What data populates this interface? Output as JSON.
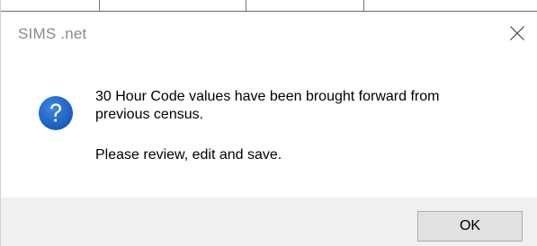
{
  "dialog": {
    "title": "SIMS .net",
    "close_icon": "close-icon",
    "icon": "question-icon",
    "message_line1": "30 Hour Code values have been brought forward from",
    "message_line2": "previous census.",
    "message_line3": "Please review, edit and save.",
    "ok_label": "OK"
  },
  "colors": {
    "title_text": "#8a8a8a",
    "icon_fill": "#1a64c8",
    "footer_bg": "#f0f0f0",
    "button_bg": "#e1e1e1",
    "button_border": "#adadad"
  }
}
